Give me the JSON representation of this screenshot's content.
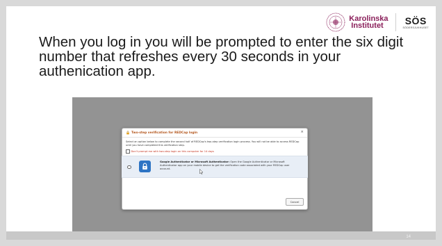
{
  "slide": {
    "headline": "When you log in you will be prompted to enter the six digit number that refreshes every 30 seconds in your authenication app.",
    "page_number": "14",
    "logos": {
      "ki_line1": "Karolinska",
      "ki_line2": "Institutet",
      "sos_mark": "SÖS",
      "sos_sub": "SÖDERSJUKHUSET",
      "ki_color": "#8a1f5a"
    }
  },
  "dialog": {
    "title": "Two-step verification for REDCap login",
    "close_label": "×",
    "intro": "Select an option below to complete the second half of REDCap's two-step verification login process. You will not be able to access REDCap until you have completed this verification step.",
    "skip_checkbox_label": "Don't prompt me with two-step login on this computer for 14 days",
    "option": {
      "title": "Google Authenticator or Microsoft Authenticator:",
      "description": "Open the Google Authenticator or Microsoft Authenticator app on your mobile device to get the verification code associated with your REDCap user account.",
      "icon": "authenticator-lock-icon",
      "accent_color": "#2d74c4"
    },
    "cancel_label": "Cancel",
    "title_color": "#b3551b"
  }
}
